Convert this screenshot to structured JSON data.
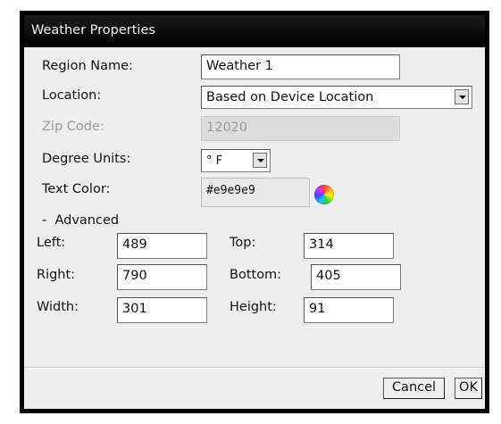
{
  "title": "Weather Properties",
  "form": {
    "region_label": "Region Name:",
    "region_value": "Weather 1",
    "location_label": "Location:",
    "location_value": "Based on Device Location",
    "zip_label": "Zip Code:",
    "zip_value": "12020",
    "degree_label": "Degree Units:",
    "degree_value": "° F",
    "textcolor_label": "Text Color:",
    "textcolor_value": "#e9e9e9"
  },
  "advanced": {
    "toggle": "-  Advanced",
    "left_label": "Left:",
    "left_value": "489",
    "top_label": "Top:",
    "top_value": "314",
    "right_label": "Right:",
    "right_value": "790",
    "bottom_label": "Bottom:",
    "bottom_value": "405",
    "width_label": "Width:",
    "width_value": "301",
    "height_label": "Height:",
    "height_value": "91"
  },
  "buttons": {
    "cancel": "Cancel",
    "ok": "OK"
  },
  "colors": {
    "titlebar": "#000000",
    "client": "#eeeeee",
    "textcolor_swatch": "#e9e9e9"
  }
}
